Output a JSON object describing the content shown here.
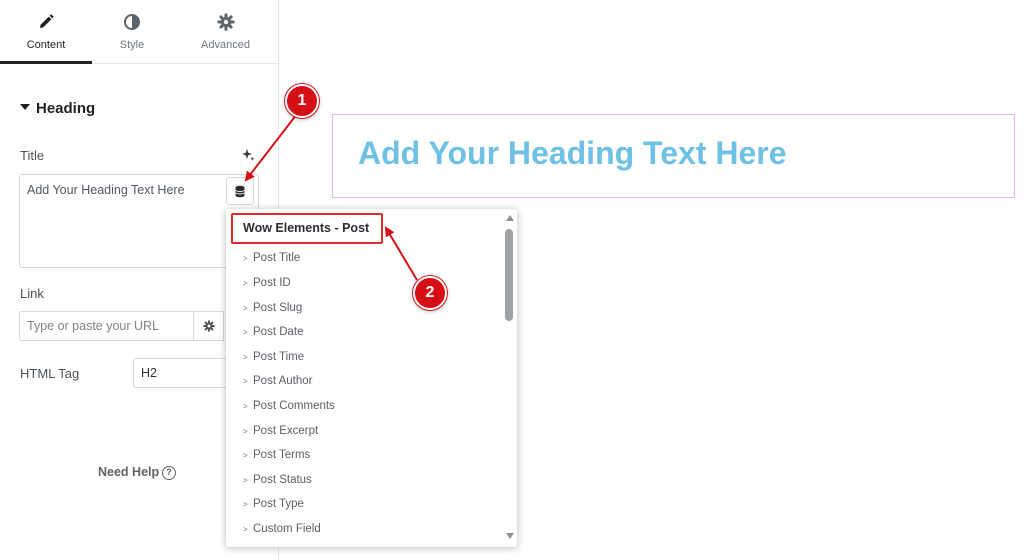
{
  "tabs": [
    {
      "label": "Content",
      "icon": "pencil-icon",
      "active": true
    },
    {
      "label": "Style",
      "icon": "contrast-icon",
      "active": false
    },
    {
      "label": "Advanced",
      "icon": "gear-icon",
      "active": false
    }
  ],
  "section": {
    "title": "Heading",
    "icon": "caret-down-icon"
  },
  "title_field": {
    "label": "Title",
    "value": "Add Your Heading Text Here",
    "ai_icon": "sparkle-icon",
    "dynamic_icon": "database-icon"
  },
  "link_field": {
    "label": "Link",
    "placeholder": "Type or paste your URL",
    "settings_icon": "gear-icon"
  },
  "html_tag": {
    "label": "HTML Tag",
    "value": "H2"
  },
  "help": {
    "label": "Need Help",
    "icon": "question-circle-icon"
  },
  "canvas": {
    "heading": "Add Your Heading Text Here",
    "heading_color": "#6ec1e4"
  },
  "dropdown": {
    "group": "Wow Elements - Post",
    "items": [
      "Post Title",
      "Post ID",
      "Post Slug",
      "Post Date",
      "Post Time",
      "Post Author",
      "Post Comments",
      "Post Excerpt",
      "Post Terms",
      "Post Status",
      "Post Type",
      "Custom Field"
    ]
  },
  "callouts": [
    "1",
    "2"
  ],
  "colors": {
    "accent_red": "#d60f16",
    "frame_border": "#e3b3f0",
    "heading_blue": "#6ec1e4"
  }
}
